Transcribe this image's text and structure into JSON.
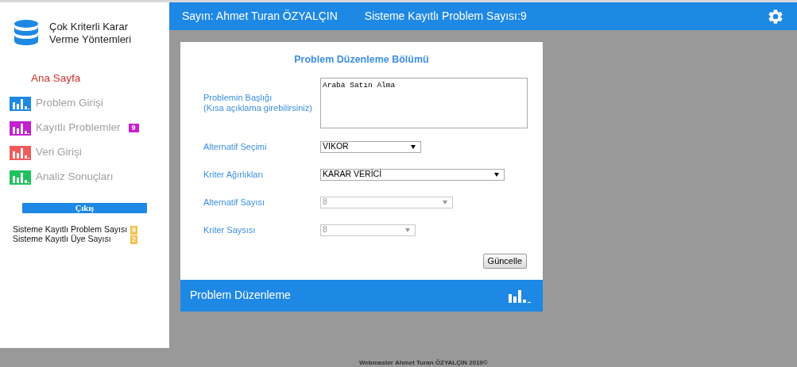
{
  "sidebar": {
    "logo_title": "Çok Kriterli Karar Verme Yöntemleri",
    "items": [
      {
        "label": "Ana Sayfa",
        "kind": "home"
      },
      {
        "label": "Problem Girişi",
        "kind": "icon",
        "color": "#1e88e5"
      },
      {
        "label": "Kayıtlı Problemler",
        "kind": "icon",
        "color": "#c41fd1",
        "badge": "9"
      },
      {
        "label": "Veri Girişi",
        "kind": "icon",
        "color": "#f25b5b"
      },
      {
        "label": "Analiz Sonuçları",
        "kind": "icon",
        "color": "#1fc15e"
      }
    ],
    "logout": "Çıkış",
    "stats": [
      {
        "label": "Sisteme Kayıtlı Problem Sayısı",
        "value": "9"
      },
      {
        "label": "Sisteme Kayıtlı Üye Sayısı",
        "value": "2"
      }
    ]
  },
  "header": {
    "user": "Sayın: Ahmet Turan ÖZYALÇIN",
    "count": "Sisteme Kayıtlı Problem Sayısı:9"
  },
  "form": {
    "title": "Problem Düzenleme Bölümü",
    "fields": [
      {
        "label": "Problemin Başlığı\n(Kısa açıklama girebilirsiniz)",
        "kind": "textarea",
        "value": "Araba Satın Alma",
        "disabled": false
      },
      {
        "label": "Alternatif Seçimi",
        "kind": "select",
        "value": "VIKOR",
        "disabled": false
      },
      {
        "label": "Kriter Ağırlıkları",
        "kind": "select-wide",
        "value": "KARAR VERİCİ",
        "disabled": false
      },
      {
        "label": "Alternatif Sayısı",
        "kind": "select-wide",
        "value": "8",
        "disabled": true
      },
      {
        "label": "Kriter Saysısı",
        "kind": "select",
        "value": "8",
        "disabled": true
      }
    ],
    "button": "Güncelle",
    "footer": "Problem Düzenleme"
  },
  "footer": "Webmaster Ahmet Turan ÖZYALÇIN 2019©"
}
